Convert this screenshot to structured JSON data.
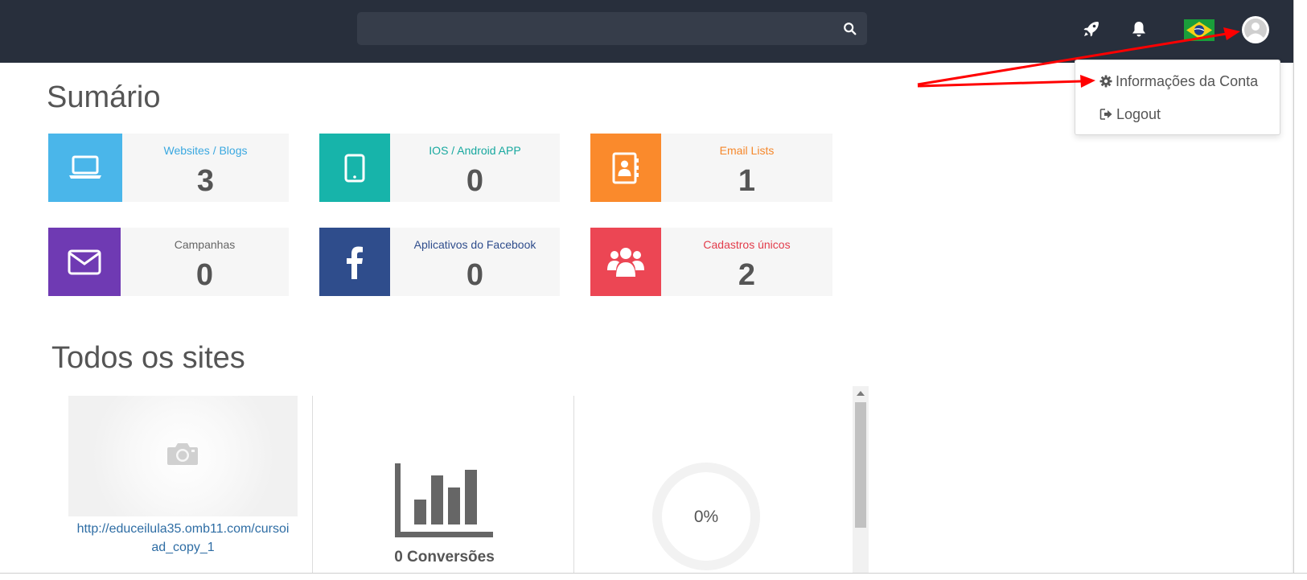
{
  "search": {
    "value": "",
    "placeholder": ""
  },
  "header_icons": [
    "rocket-icon",
    "bell-icon",
    "brazil-flag-icon",
    "user-avatar"
  ],
  "account_menu": {
    "items": [
      {
        "label": "Informações da Conta",
        "icon": "gear-icon"
      },
      {
        "label": "Logout",
        "icon": "sign-out-icon"
      }
    ]
  },
  "summary": {
    "title": "Sumário",
    "cards": [
      {
        "label": "Websites / Blogs",
        "value": "3",
        "icon": "laptop-icon",
        "color": "#4ab6ea",
        "label_color": "#3aa8e0"
      },
      {
        "label": "IOS / Android APP",
        "value": "0",
        "icon": "tablet-icon",
        "color": "#17b4aa",
        "label_color": "#17a89f"
      },
      {
        "label": "Email Lists",
        "value": "1",
        "icon": "address-book-icon",
        "color": "#fa8a2c",
        "label_color": "#f5872a"
      },
      {
        "label": "Campanhas",
        "value": "0",
        "icon": "envelope-icon",
        "color": "#6f3ab3",
        "label_color": "#666666"
      },
      {
        "label": "Aplicativos do Facebook",
        "value": "0",
        "icon": "facebook-icon",
        "color": "#2f4d8c",
        "label_color": "#2f4d8c"
      },
      {
        "label": "Cadastros únicos",
        "value": "2",
        "icon": "users-icon",
        "color": "#ec4654",
        "label_color": "#e23c4b"
      }
    ]
  },
  "sites": {
    "title": "Todos os sites",
    "site_url_line1": "http://educeilula35.omb11.com/cursoi",
    "site_url_line2": "ad_copy_1",
    "conversions_label": "0 Conversões",
    "conversion_percent": "0%",
    "conversion_rate": 0
  },
  "annotation_color": "#ff0000"
}
